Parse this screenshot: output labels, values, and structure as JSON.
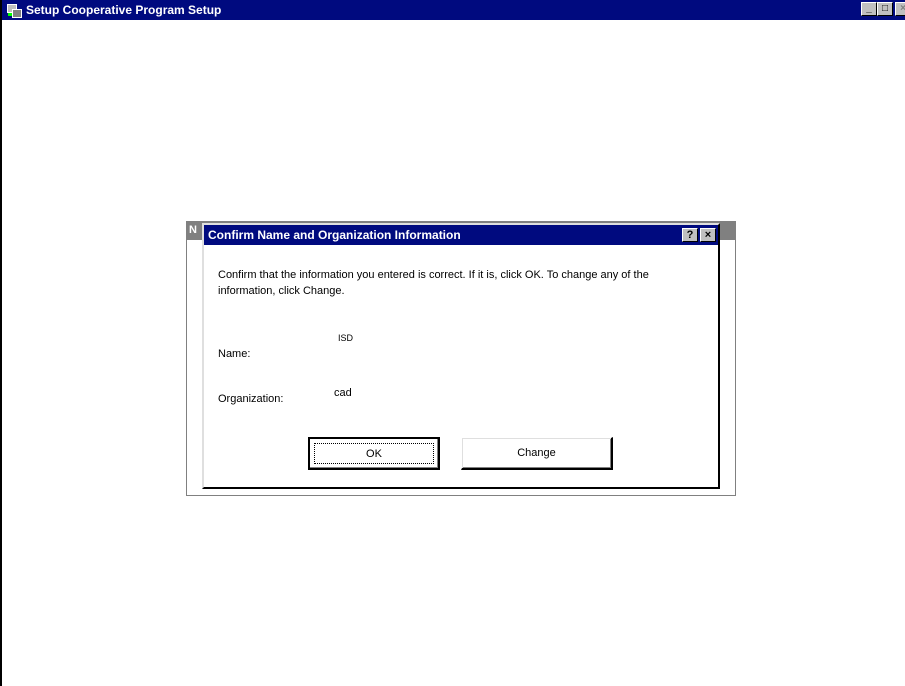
{
  "main_window": {
    "title": "Setup Cooperative Program Setup",
    "minimize_label": "_",
    "maximize_label": "□",
    "close_label": "×"
  },
  "back_dialog": {
    "title_fragment": "N"
  },
  "dialog": {
    "title": "Confirm Name and Organization Information",
    "help_label": "?",
    "close_label": "×",
    "message": "Confirm that the information you entered is correct. If it is, click OK. To change any of the information, click Change.",
    "name_label": "Name:",
    "name_value": "ISD",
    "organization_label": "Organization:",
    "organization_value": "cad",
    "ok_label": "OK",
    "change_label": "Change"
  },
  "colors": {
    "titlebar_active": "#000a7f",
    "titlebar_inactive": "#808080",
    "button_face": "#c0c0c0"
  }
}
